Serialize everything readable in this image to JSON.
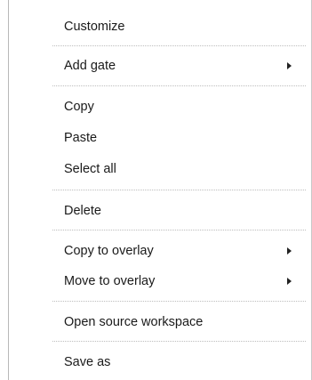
{
  "context_menu": {
    "items": [
      {
        "label": "Customize"
      },
      {
        "label": "Add gate",
        "submenu": true
      },
      {
        "label": "Copy"
      },
      {
        "label": "Paste"
      },
      {
        "label": "Select all"
      },
      {
        "label": "Delete"
      },
      {
        "label": "Copy to overlay",
        "submenu": true
      },
      {
        "label": "Move to overlay",
        "submenu": true
      },
      {
        "label": "Open source workspace"
      },
      {
        "label": "Save as"
      }
    ],
    "icons": {
      "submenu_arrow": "chevron-right-icon"
    },
    "colors": {
      "text": "#1a1a1a",
      "separator": "#bdbdbd",
      "background": "#ffffff"
    }
  }
}
